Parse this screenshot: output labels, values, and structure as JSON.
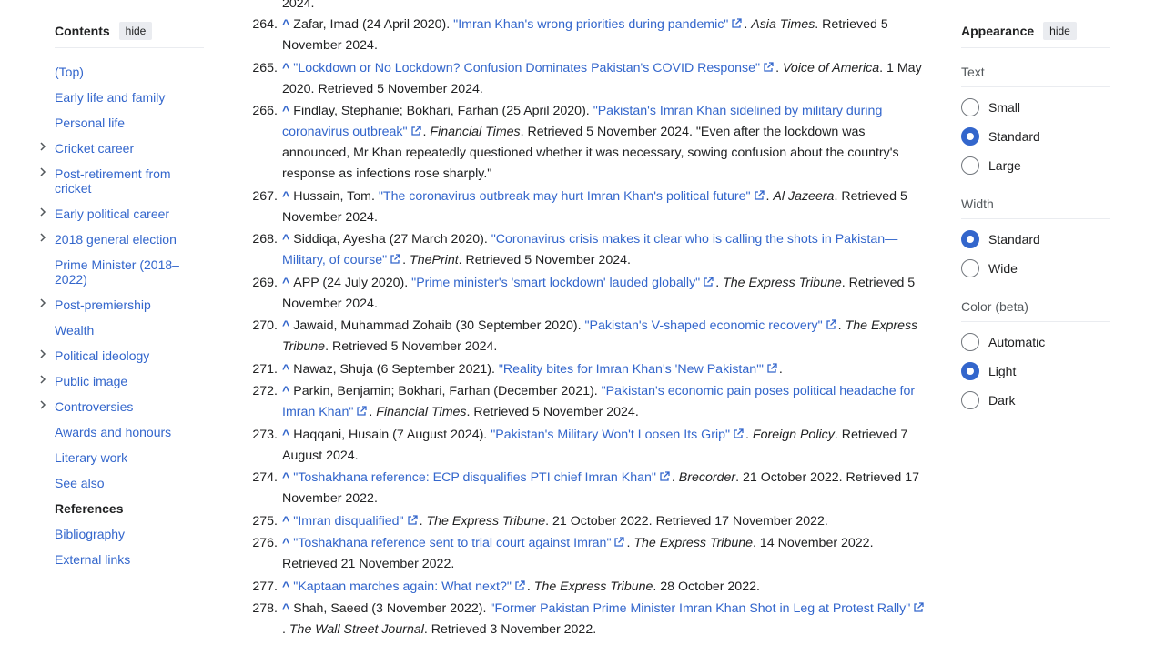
{
  "toc": {
    "title": "Contents",
    "hide_label": "hide",
    "items": [
      {
        "label": "(Top)",
        "expandable": false
      },
      {
        "label": "Early life and family",
        "expandable": false
      },
      {
        "label": "Personal life",
        "expandable": false
      },
      {
        "label": "Cricket career",
        "expandable": true
      },
      {
        "label": "Post-retirement from cricket",
        "expandable": true
      },
      {
        "label": "Early political career",
        "expandable": true
      },
      {
        "label": "2018 general election",
        "expandable": true
      },
      {
        "label": "Prime Minister (2018–2022)",
        "expandable": false
      },
      {
        "label": "Post-premiership",
        "expandable": true
      },
      {
        "label": "Wealth",
        "expandable": false
      },
      {
        "label": "Political ideology",
        "expandable": true
      },
      {
        "label": "Public image",
        "expandable": true
      },
      {
        "label": "Controversies",
        "expandable": true
      },
      {
        "label": "Awards and honours",
        "expandable": false
      },
      {
        "label": "Literary work",
        "expandable": false
      },
      {
        "label": "See also",
        "expandable": false
      },
      {
        "label": "References",
        "expandable": false,
        "current": true
      },
      {
        "label": "Bibliography",
        "expandable": false
      },
      {
        "label": "External links",
        "expandable": false
      }
    ]
  },
  "references": {
    "partial_top": "2024.",
    "items": [
      {
        "num": "264.",
        "pre": "Zafar, Imad (24 April 2020). ",
        "title": "\"Imran Khan's wrong priorities during pandemic\"",
        "work": "Asia Times",
        "post": ". Retrieved 5 November 2024."
      },
      {
        "num": "265.",
        "pre": "",
        "title": "\"Lockdown or No Lockdown? Confusion Dominates Pakistan's COVID Response\"",
        "work": "Voice of America",
        "post": ". 1 May 2020. Retrieved 5 November 2024."
      },
      {
        "num": "266.",
        "pre": "Findlay, Stephanie; Bokhari, Farhan (25 April 2020). ",
        "title": "\"Pakistan's Imran Khan sidelined by military during coronavirus outbreak\"",
        "work": "Financial Times",
        "post": ". Retrieved 5 November 2024. \"Even after the lockdown was announced, Mr Khan repeatedly questioned whether it was necessary, sowing confusion about the country's response as infections rose sharply.\""
      },
      {
        "num": "267.",
        "pre": "Hussain, Tom. ",
        "title": "\"The coronavirus outbreak may hurt Imran Khan's political future\"",
        "work": "Al Jazeera",
        "post": ". Retrieved 5 November 2024."
      },
      {
        "num": "268.",
        "pre": "Siddiqa, Ayesha (27 March 2020). ",
        "title": "\"Coronavirus crisis makes it clear who is calling the shots in Pakistan—Military, of course\"",
        "work": "ThePrint",
        "post": ". Retrieved 5 November 2024."
      },
      {
        "num": "269.",
        "pre": "APP (24 July 2020). ",
        "title": "\"Prime minister's 'smart lockdown' lauded globally\"",
        "work": "The Express Tribune",
        "post": ". Retrieved 5 November 2024."
      },
      {
        "num": "270.",
        "pre": "Jawaid, Muhammad Zohaib (30 September 2020). ",
        "title": "\"Pakistan's V-shaped economic recovery\"",
        "work": "The Express Tribune",
        "post": ". Retrieved 5 November 2024."
      },
      {
        "num": "271.",
        "pre": "Nawaz, Shuja (6 September 2021). ",
        "title": "\"Reality bites for Imran Khan's 'New Pakistan'\"",
        "work": "",
        "post": "."
      },
      {
        "num": "272.",
        "pre": "Parkin, Benjamin; Bokhari, Farhan (December 2021). ",
        "title": "\"Pakistan's economic pain poses political headache for Imran Khan\"",
        "work": "Financial Times",
        "post": ". Retrieved 5 November 2024."
      },
      {
        "num": "273.",
        "pre": "Haqqani, Husain (7 August 2024). ",
        "title": "\"Pakistan's Military Won't Loosen Its Grip\"",
        "work": "Foreign Policy",
        "post": ". Retrieved 7 August 2024."
      },
      {
        "num": "274.",
        "pre": "",
        "title": "\"Toshakhana reference: ECP disqualifies PTI chief Imran Khan\"",
        "work": "Brecorder",
        "post": ". 21 October 2022. Retrieved 17 November 2022."
      },
      {
        "num": "275.",
        "pre": "",
        "title": "\"Imran disqualified\"",
        "work": "The Express Tribune",
        "post": ". 21 October 2022. Retrieved 17 November 2022."
      },
      {
        "num": "276.",
        "pre": "",
        "title": "\"Toshakhana reference sent to trial court against Imran\"",
        "work": "The Express Tribune",
        "post": ". 14 November 2022. Retrieved 21 November 2022."
      },
      {
        "num": "277.",
        "pre": "",
        "title": "\"Kaptaan marches again: What next?\"",
        "work": "The Express Tribune",
        "post": ". 28 October 2022."
      },
      {
        "num": "278.",
        "pre": "Shah, Saeed (3 November 2022). ",
        "title": "\"Former Pakistan Prime Minister Imran Khan Shot in Leg at Protest Rally\"",
        "work": "The Wall Street Journal",
        "post": ". Retrieved 3 November 2022."
      }
    ]
  },
  "appearance": {
    "title": "Appearance",
    "hide_label": "hide",
    "groups": [
      {
        "label": "Text",
        "options": [
          {
            "label": "Small",
            "checked": false
          },
          {
            "label": "Standard",
            "checked": true
          },
          {
            "label": "Large",
            "checked": false
          }
        ]
      },
      {
        "label": "Width",
        "options": [
          {
            "label": "Standard",
            "checked": true
          },
          {
            "label": "Wide",
            "checked": false
          }
        ]
      },
      {
        "label": "Color (beta)",
        "options": [
          {
            "label": "Automatic",
            "checked": false
          },
          {
            "label": "Light",
            "checked": true
          },
          {
            "label": "Dark",
            "checked": false
          }
        ]
      }
    ]
  },
  "colors": {
    "link": "#3366cc",
    "text": "#202122",
    "accent": "#3366cc"
  },
  "icons": {
    "external_link": "external-link-icon",
    "expand": "chevron-right-icon",
    "backlink": "caret-up-icon"
  }
}
